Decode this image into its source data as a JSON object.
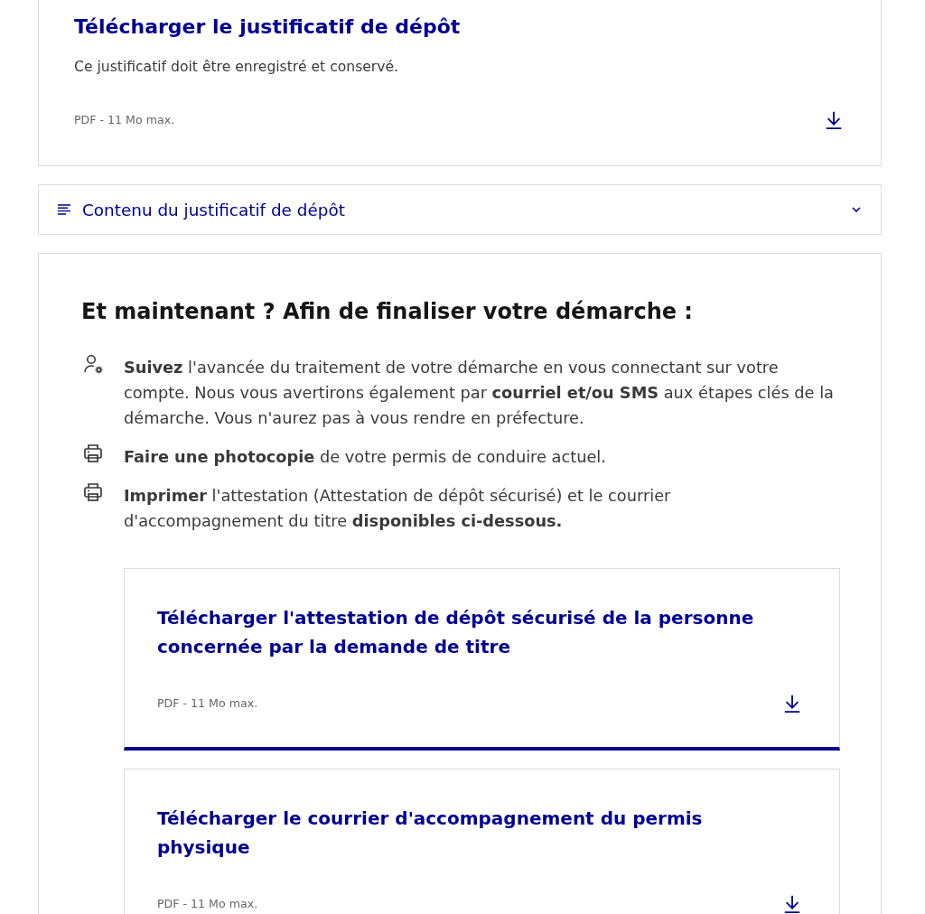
{
  "download_card": {
    "title": "Télécharger le justificatif de dépôt",
    "description": "Ce justificatif doit être enregistré et conservé.",
    "file_info": "PDF - 11 Mo max.",
    "highlighted": false
  },
  "accordion": {
    "label": "Contenu du justificatif de dépôt",
    "expanded": false
  },
  "next_steps": {
    "heading": "Et maintenant ? Afin de finaliser votre démarche :",
    "items": [
      {
        "kind": "account",
        "text": "**Suivez** l'avancée du traitement de votre démarche en vous connectant sur votre compte. Nous vous avertirons également par **courriel et/ou SMS** aux étapes clés de la démarche. Vous n'aurez pas à vous rendre en préfecture."
      },
      {
        "kind": "print",
        "text": "**Faire une photocopie** de votre permis de conduire actuel."
      },
      {
        "kind": "print",
        "text": "**Imprimer** l'attestation (Attestation de dépôt sécurisé) et le courrier d'accompagnement du titre **disponibles ci-dessous.**"
      }
    ],
    "downloads": [
      {
        "title": "Télécharger l'attestation de dépôt sécurisé de la personne concernée par la demande de titre",
        "file_info": "PDF - 11 Mo max.",
        "highlighted": true
      },
      {
        "title": "Télécharger le courrier d'accompagnement du permis physique",
        "file_info": "PDF - 11 Mo max."
      }
    ]
  }
}
